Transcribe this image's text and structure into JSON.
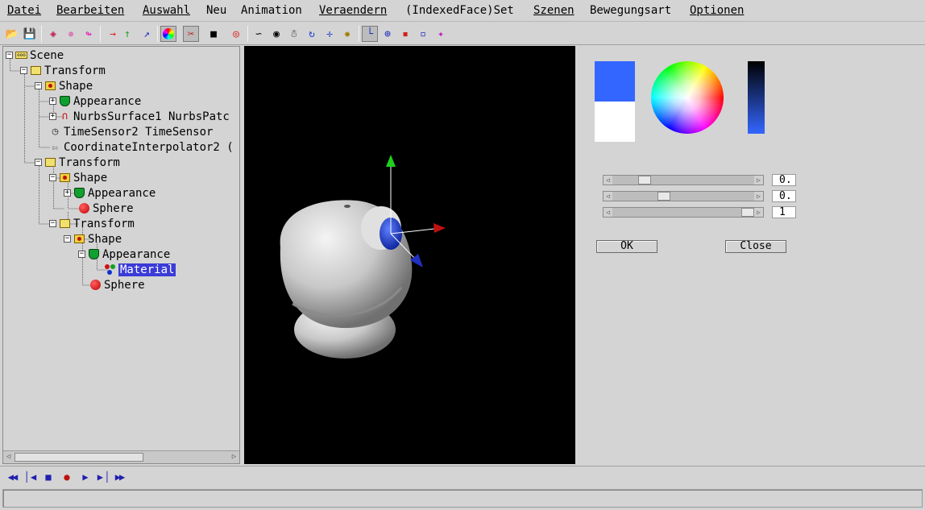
{
  "menu": [
    {
      "label": "Datei"
    },
    {
      "label": "Bearbeiten"
    },
    {
      "label": "Auswahl"
    },
    {
      "label": "Neu"
    },
    {
      "label": "Animation"
    },
    {
      "label": "Veraendern"
    },
    {
      "label": "(IndexedFace)Set"
    },
    {
      "label": "Szenen"
    },
    {
      "label": "Bewegungsart"
    },
    {
      "label": "Optionen"
    }
  ],
  "toolbar": {
    "icons": [
      "open-file-icon",
      "save-file-icon",
      "texture-icon",
      "sparkle-icon",
      "arrow-curve-icon",
      "move-x-icon",
      "move-y-icon",
      "move-z-icon",
      "color-wheel-icon",
      "cut-icon",
      "stop-square-icon",
      "target-icon",
      "curve-icon",
      "eye-icon",
      "walk-icon",
      "rotate-icon",
      "cross-arrows-icon",
      "star-icon",
      "axes-icon",
      "globe-icon",
      "shape-red-icon",
      "shape-blue-icon",
      "shape-color-icon"
    ]
  },
  "tree": {
    "nodes": [
      {
        "label": "Scene",
        "icon": "scene-icon",
        "depth": 0,
        "expander": "minus"
      },
      {
        "label": "Transform",
        "icon": "transform-icon",
        "depth": 1,
        "expander": "minus"
      },
      {
        "label": "Shape",
        "icon": "shape-icon",
        "depth": 2,
        "expander": "minus"
      },
      {
        "label": "Appearance",
        "icon": "appearance-icon",
        "depth": 3,
        "expander": "plus"
      },
      {
        "label": "NurbsSurface1 NurbsPatc",
        "icon": "nurbs-icon",
        "depth": 3,
        "expander": "plus"
      },
      {
        "label": "TimeSensor2 TimeSensor",
        "icon": "timesensor-icon",
        "depth": 2,
        "expander": ""
      },
      {
        "label": "CoordinateInterpolator2 (",
        "icon": "interpolator-icon",
        "depth": 2,
        "expander": ""
      },
      {
        "label": "Transform",
        "icon": "transform-icon",
        "depth": 2,
        "expander": "minus"
      },
      {
        "label": "Shape",
        "icon": "shape-icon",
        "depth": 3,
        "expander": "minus"
      },
      {
        "label": "Appearance",
        "icon": "appearance-icon",
        "depth": 4,
        "expander": "plus"
      },
      {
        "label": "Sphere",
        "icon": "sphere-icon",
        "depth": 4,
        "expander": ""
      },
      {
        "label": "Transform",
        "icon": "transform-icon",
        "depth": 3,
        "expander": "minus"
      },
      {
        "label": "Shape",
        "icon": "shape-icon",
        "depth": 4,
        "expander": "minus"
      },
      {
        "label": "Appearance",
        "icon": "appearance-icon",
        "depth": 5,
        "expander": "minus"
      },
      {
        "label": "Material",
        "icon": "material-icon",
        "depth": 6,
        "expander": "",
        "selected": true
      },
      {
        "label": "Sphere",
        "icon": "sphere-icon",
        "depth": 5,
        "expander": ""
      }
    ]
  },
  "color_editor": {
    "current_color": "#3366ff",
    "previous_color": "#ffffff",
    "sliders": [
      {
        "value": "0.",
        "level": 0.2
      },
      {
        "value": "0.",
        "level": 0.35
      },
      {
        "value": "1",
        "level": 1.0
      }
    ],
    "ok_label": "OK",
    "close_label": "Close"
  },
  "animation": {
    "buttons": [
      "rewind-icon",
      "skip-back-icon",
      "stop-icon",
      "record-icon",
      "play-icon",
      "skip-forward-icon",
      "fast-forward-icon"
    ]
  },
  "status": {
    "text": ""
  }
}
